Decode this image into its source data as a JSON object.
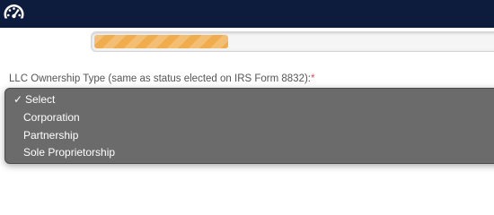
{
  "header": {
    "icon": "speedometer-icon",
    "background_color": "#0d1b3d"
  },
  "progress": {
    "percent": 33,
    "color": "#f0ad4e"
  },
  "ownership_field": {
    "label": "LLC Ownership Type (same as status elected on IRS Form 8832):",
    "required_marker": "*",
    "selected_value": "Select",
    "check_mark": "✓",
    "options": [
      {
        "label": "Select",
        "selected": true
      },
      {
        "label": "Corporation",
        "selected": false
      },
      {
        "label": "Partnership",
        "selected": false
      },
      {
        "label": "Sole Proprietorship",
        "selected": false
      }
    ]
  }
}
